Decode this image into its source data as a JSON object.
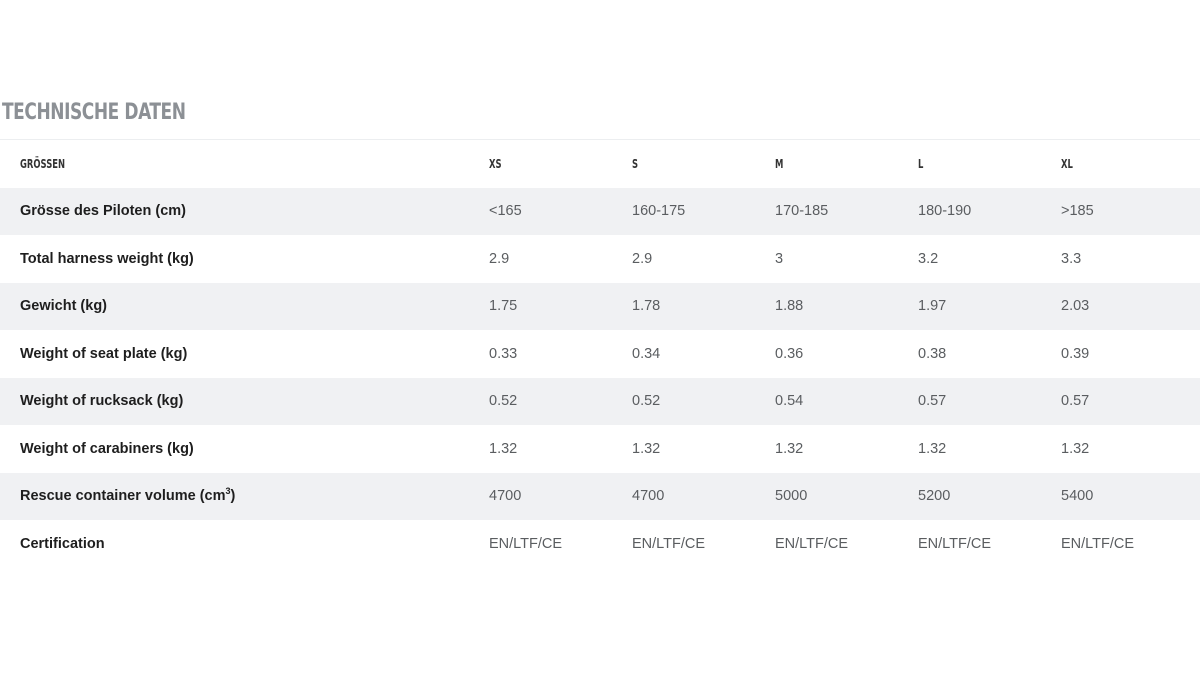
{
  "section": {
    "title": "TECHNISCHE DATEN"
  },
  "table": {
    "header": {
      "label": "GRÖSSEN",
      "sizes": [
        "XS",
        "S",
        "M",
        "L",
        "XL"
      ]
    },
    "rows": [
      {
        "label": "Grösse des Piloten (cm)",
        "values": [
          "<165",
          "160-175",
          "170-185",
          "180-190",
          ">185"
        ]
      },
      {
        "label": "Total harness weight (kg)",
        "values": [
          "2.9",
          "2.9",
          "3",
          "3.2",
          "3.3"
        ]
      },
      {
        "label": "Gewicht (kg)",
        "values": [
          "1.75",
          "1.78",
          "1.88",
          "1.97",
          "2.03"
        ]
      },
      {
        "label": "Weight of seat plate (kg)",
        "values": [
          "0.33",
          "0.34",
          "0.36",
          "0.38",
          "0.39"
        ]
      },
      {
        "label": "Weight of rucksack (kg)",
        "values": [
          "0.52",
          "0.52",
          "0.54",
          "0.57",
          "0.57"
        ]
      },
      {
        "label": "Weight of carabiners (kg)",
        "values": [
          "1.32",
          "1.32",
          "1.32",
          "1.32",
          "1.32"
        ]
      },
      {
        "label_main": "Rescue container volume (cm",
        "label_sup": "3",
        "label_end": ")",
        "values": [
          "4700",
          "4700",
          "5000",
          "5200",
          "5400"
        ]
      },
      {
        "label": "Certification",
        "values": [
          "EN/LTF/CE",
          "EN/LTF/CE",
          "EN/LTF/CE",
          "EN/LTF/CE",
          "EN/LTF/CE"
        ]
      }
    ]
  },
  "colors": {
    "title": "#8c9095",
    "stripe": "#f0f1f3",
    "label_text": "#1e1e1e",
    "value_text": "#5a5d60"
  }
}
